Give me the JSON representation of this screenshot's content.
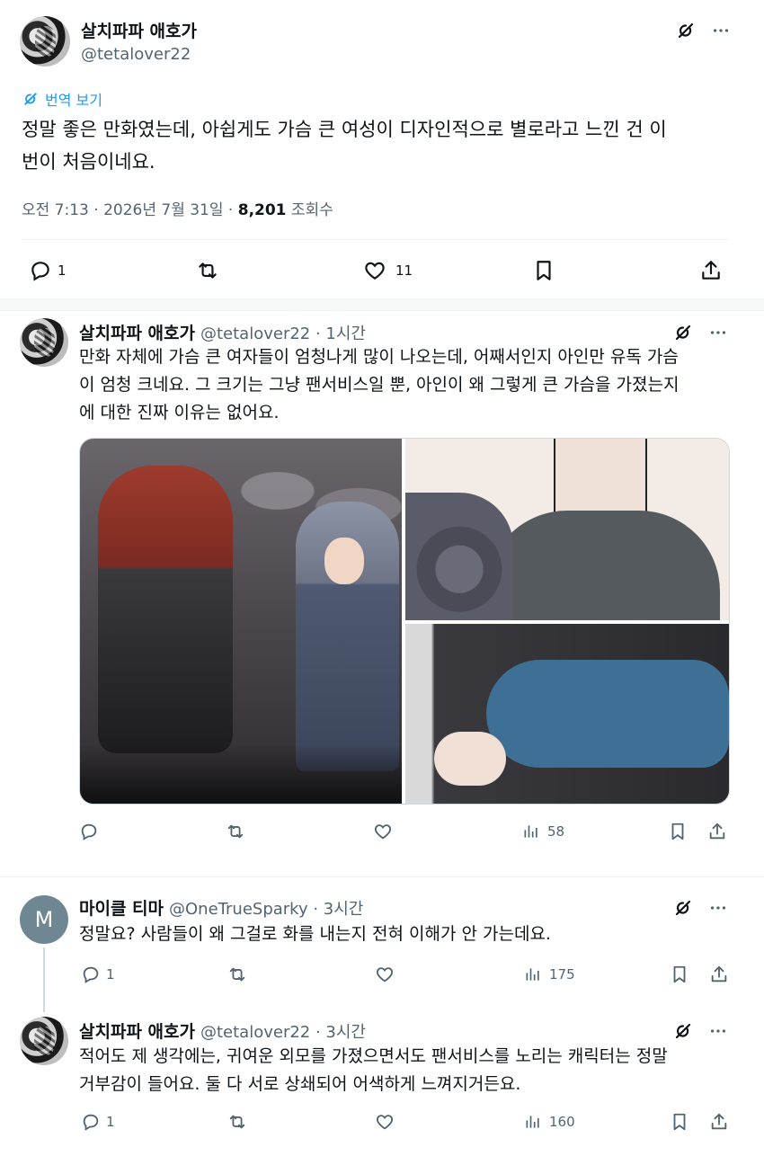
{
  "main_tweet": {
    "display_name": "살치파파 애호가",
    "handle": "@tetalover22",
    "translate_label": "번역 보기",
    "text_line1": "정말 좋은 만화였는데, 아쉽게도 가슴 큰 여성이 디자인적으로 별로라고 느낀 건 이",
    "text_line2": "번이 처음이네요.",
    "time": "오전 7:13 · 2026년 7월 31일 ·",
    "views": "8,201",
    "views_label": "조회수",
    "replies": "1",
    "likes": "11"
  },
  "reply1": {
    "display_name": "살치파파 애호가",
    "handle": "@tetalover22 · 1시간",
    "text_line1": "만화 자체에 가슴 큰 여자들이 엄청나게 많이 나오는데, 어째서인지 아인만 유독 가슴",
    "text_line2": "이 엄청 크네요. 그 크기는 그냥 팬서비스일 뿐, 아인이 왜 그렇게 큰 가슴을 가졌는지",
    "text_line3": "에 대한 진짜 이유는 없어요.",
    "views": "58"
  },
  "reply2": {
    "avatar_letter": "M",
    "display_name": "마이클 티마",
    "handle": "@OneTrueSparky · 3시간",
    "text_line1": "정말요? 사람들이 왜 그걸로 화를 내는지 전혀 이해가 안 가는데요.",
    "replies": "1",
    "views": "175"
  },
  "reply3": {
    "display_name": "살치파파 애호가",
    "handle": "@tetalover22 · 3시간",
    "text_line1": "적어도 제 생각에는, 귀여운 외모를 가졌으면서도 팬서비스를 노리는 캐릭터는 정말",
    "text_line2": "거부감이 들어요. 둘 다 서로 상쇄되어 어색하게 느껴지거든요.",
    "replies": "1",
    "views": "160"
  },
  "icons": {
    "grok": "grok-icon",
    "more": "more-icon",
    "reply": "reply-icon",
    "retweet": "retweet-icon",
    "like": "like-icon",
    "views": "views-icon",
    "bookmark": "bookmark-icon",
    "share": "share-icon"
  },
  "colors": {
    "text": "#0f1419",
    "secondary": "#536471",
    "link": "#1d9bf0",
    "divider": "#eff3f4"
  }
}
